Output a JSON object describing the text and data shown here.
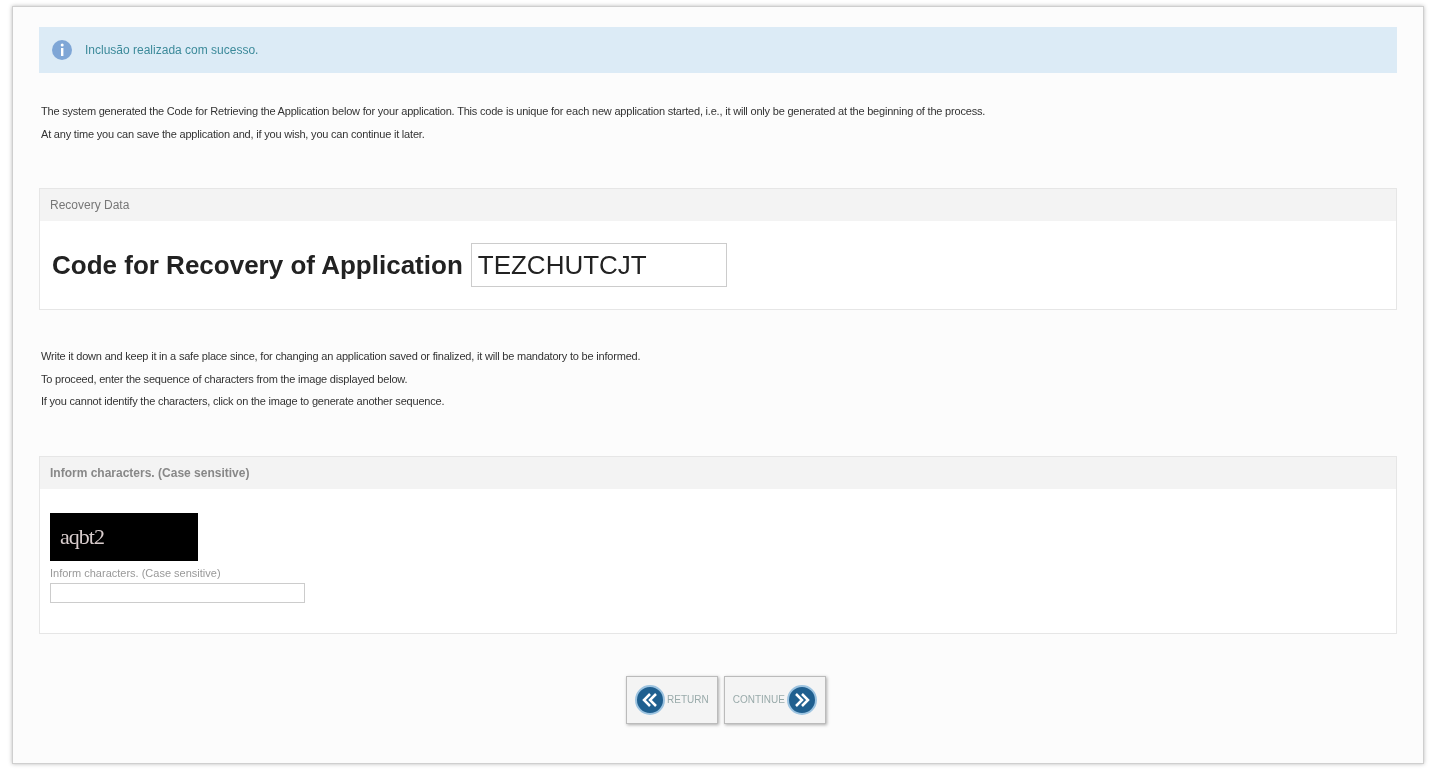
{
  "notice": {
    "text": "Inclusão realizada com sucesso."
  },
  "intro": [
    "The system generated the Code for Retrieving the Application below for your application. This code is unique for each new application started, i.e., it will only be generated at the beginning of the process.",
    "At any time you can save the application and, if you wish, you can continue it later."
  ],
  "recovery": {
    "header": "Recovery Data",
    "label": "Code for Recovery of Application",
    "code": "TEZCHUTCJT"
  },
  "instructions": [
    "Write it down and keep it in a safe place since, for changing an application saved or finalized, it will be mandatory to be informed.",
    "To proceed, enter the sequence of characters from the image displayed below.",
    "If you cannot identify the characters, click on the image to generate another sequence."
  ],
  "captcha": {
    "header": "Inform characters. (Case sensitive)",
    "image_text": "aqbt2",
    "field_label": "Inform characters. (Case sensitive)"
  },
  "buttons": [
    {
      "label": "RETURN",
      "kind": "back"
    },
    {
      "label": "CONTINUE",
      "kind": "next"
    }
  ]
}
